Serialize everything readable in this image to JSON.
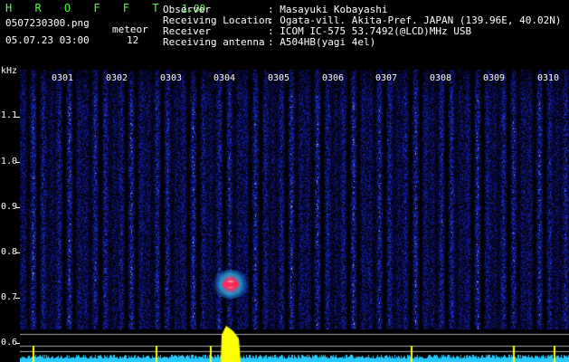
{
  "app": {
    "brand": "H R O F F T",
    "version": "1.00",
    "filename": "0507230300.png",
    "datetime": "05.07.23 03:00",
    "meteor_label": "meteor",
    "meteor_count": "12"
  },
  "info": {
    "observer_label": "Observer",
    "observer_value": ": Masayuki Kobayashi",
    "location_label": "Receiving Location",
    "location_value": ": Ogata-vill. Akita-Pref. JAPAN (139.96E, 40.02N)",
    "receiver_label": "Receiver",
    "receiver_value": ": ICOM IC-575 53.7492(@LCD)MHz USB",
    "antenna_label": "Receiving antenna",
    "antenna_value": ": A504HB(yagi 4el)"
  },
  "axis": {
    "y_unit": "kHz",
    "y_ticks": [
      "1.1",
      "1.0",
      "0.9",
      "0.8",
      "0.7",
      "0.6"
    ],
    "x_ticks": [
      "0301",
      "0302",
      "0303",
      "0304",
      "0305",
      "0306",
      "0307",
      "0308",
      "0309",
      "0310"
    ]
  },
  "colors": {
    "background": "#000000",
    "brand_green": "#52ff3a",
    "noise_blue": "#1828a8",
    "meteor_red": "#ff2a5a",
    "level_cyan": "#29c8ff",
    "level_yellow": "#ffff00"
  }
}
